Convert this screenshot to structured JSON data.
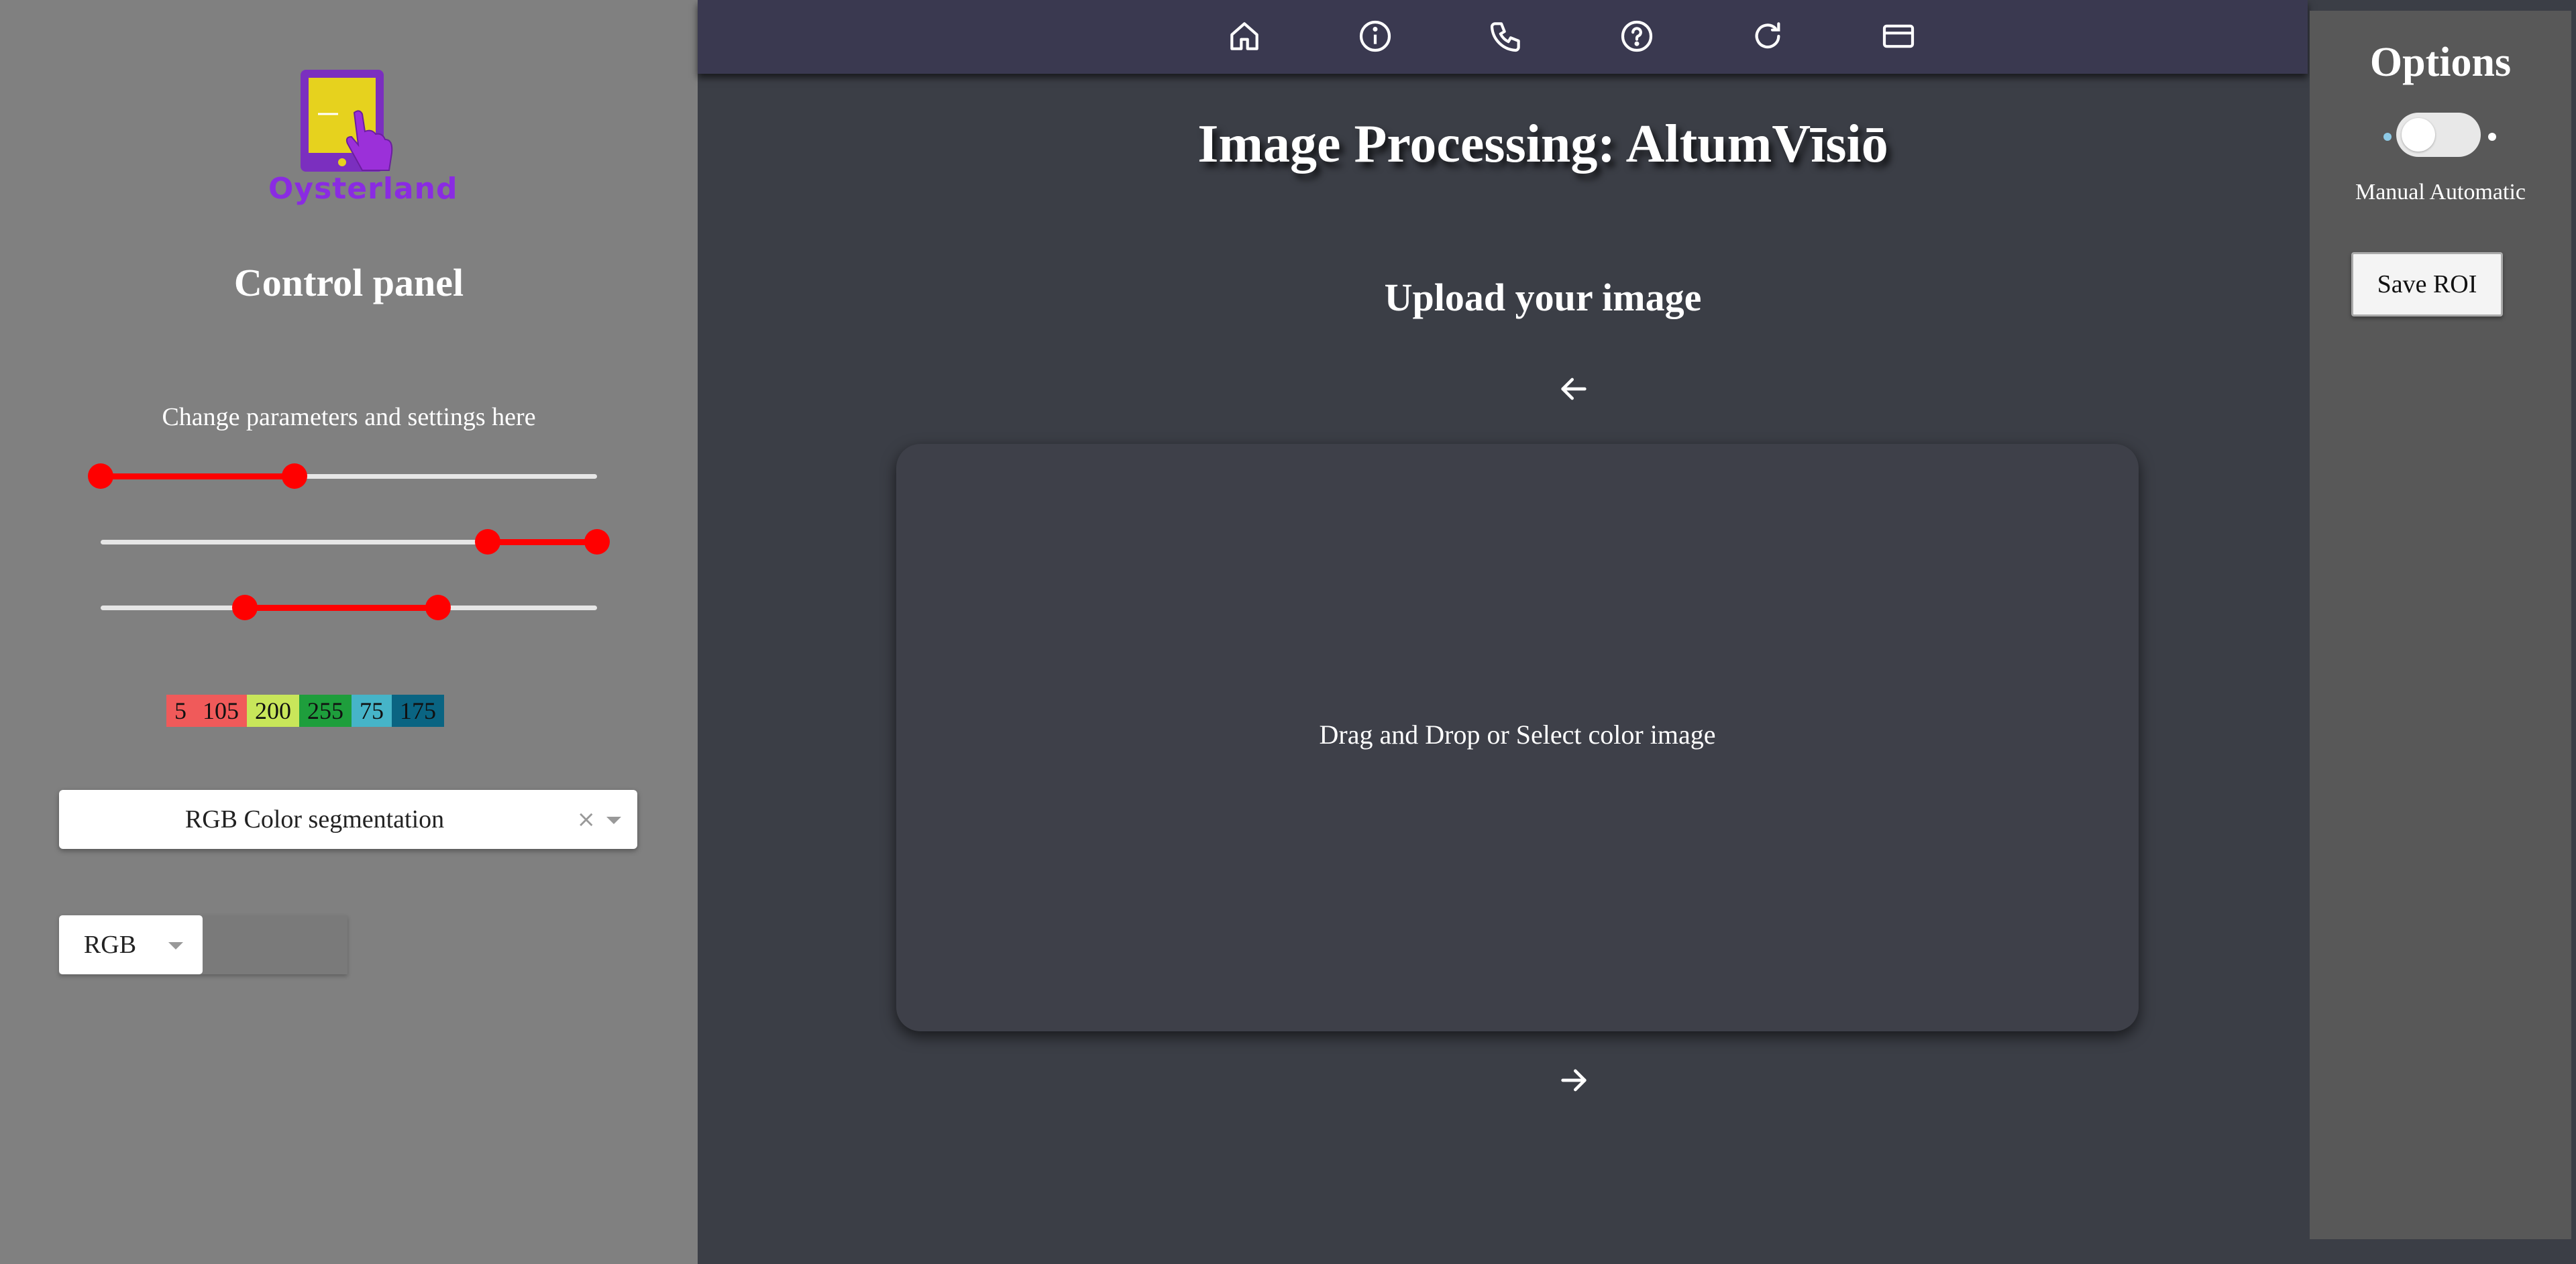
{
  "logo": {
    "text": "Oysterland"
  },
  "control_panel": {
    "title": "Control panel",
    "subtitle": "Change parameters and settings here",
    "sliders": [
      {
        "name": "slider-1",
        "low": 0,
        "high": 0.39,
        "range_min": 0,
        "range_max": 1
      },
      {
        "name": "slider-2",
        "low": 0.78,
        "high": 1.0,
        "range_min": 0,
        "range_max": 1
      },
      {
        "name": "slider-3",
        "low": 0.29,
        "high": 0.68,
        "range_min": 0,
        "range_max": 1
      }
    ],
    "color_values": [
      {
        "label": "5",
        "color": "#f05a5a"
      },
      {
        "label": "105",
        "color": "#f05a5a"
      },
      {
        "label": "200",
        "color": "#c8e65a"
      },
      {
        "label": "255",
        "color": "#1e9e3c"
      },
      {
        "label": "75",
        "color": "#46b4c8"
      },
      {
        "label": "175",
        "color": "#0a6482"
      }
    ],
    "segmentation_select": {
      "value": "RGB Color segmentation",
      "clear": "×"
    },
    "color_space_select": {
      "value": "RGB"
    }
  },
  "navbar": {
    "icons": [
      "home-icon",
      "info-icon",
      "phone-icon",
      "help-icon",
      "refresh-icon",
      "card-icon"
    ]
  },
  "main": {
    "title": "Image Processing: AltumVīsiō",
    "upload_title": "Upload your image",
    "dropzone_text": "Drag and Drop or Select color image"
  },
  "options": {
    "title": "Options",
    "mode_label": "Manual Automatic",
    "save_roi": "Save ROI",
    "toggle_dot_colors": [
      "#8ecae6",
      "#ffffff"
    ]
  },
  "colors": {
    "left_panel": "#808080",
    "main_bg": "#3b3e46",
    "navbar": "#3a3950",
    "right_panel": "#585858",
    "slider_accent": "#ff0000"
  }
}
